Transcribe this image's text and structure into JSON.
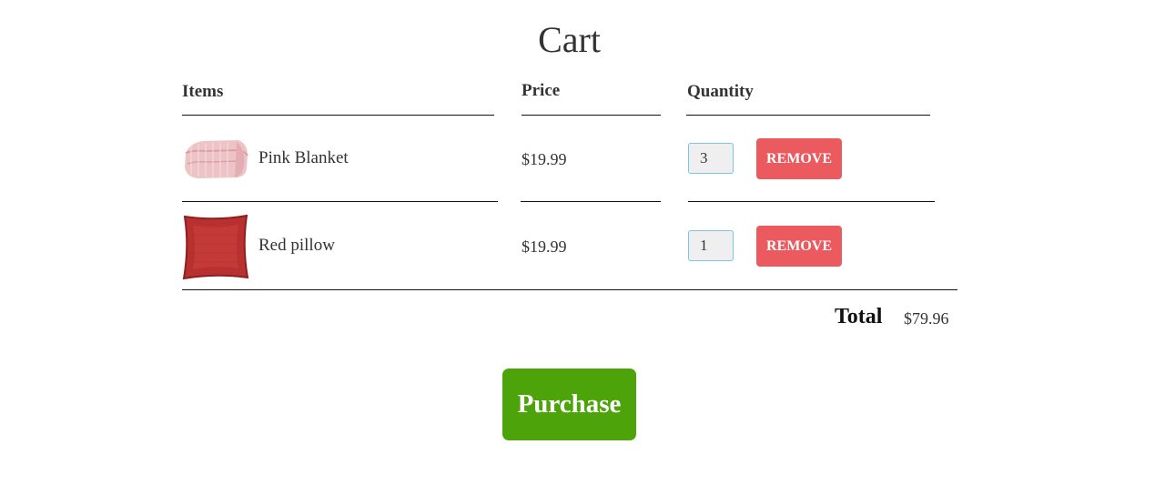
{
  "page": {
    "title": "Cart"
  },
  "columns": {
    "items": "Items",
    "price": "Price",
    "quantity": "Quantity"
  },
  "cart": [
    {
      "name": "Pink Blanket",
      "price": "$19.99",
      "quantity": "3",
      "remove_label": "REMOVE",
      "thumbnail": "pink-blanket-thumbnail"
    },
    {
      "name": "Red pillow",
      "price": "$19.99",
      "quantity": "1",
      "remove_label": "REMOVE",
      "thumbnail": "red-pillow-thumbnail"
    }
  ],
  "summary": {
    "total_label": "Total",
    "total_value": "$79.96"
  },
  "actions": {
    "purchase_label": "Purchase"
  },
  "colors": {
    "remove": "#ea5a5e",
    "purchase": "#4ca30a",
    "qty_border": "#7cc4e8"
  }
}
